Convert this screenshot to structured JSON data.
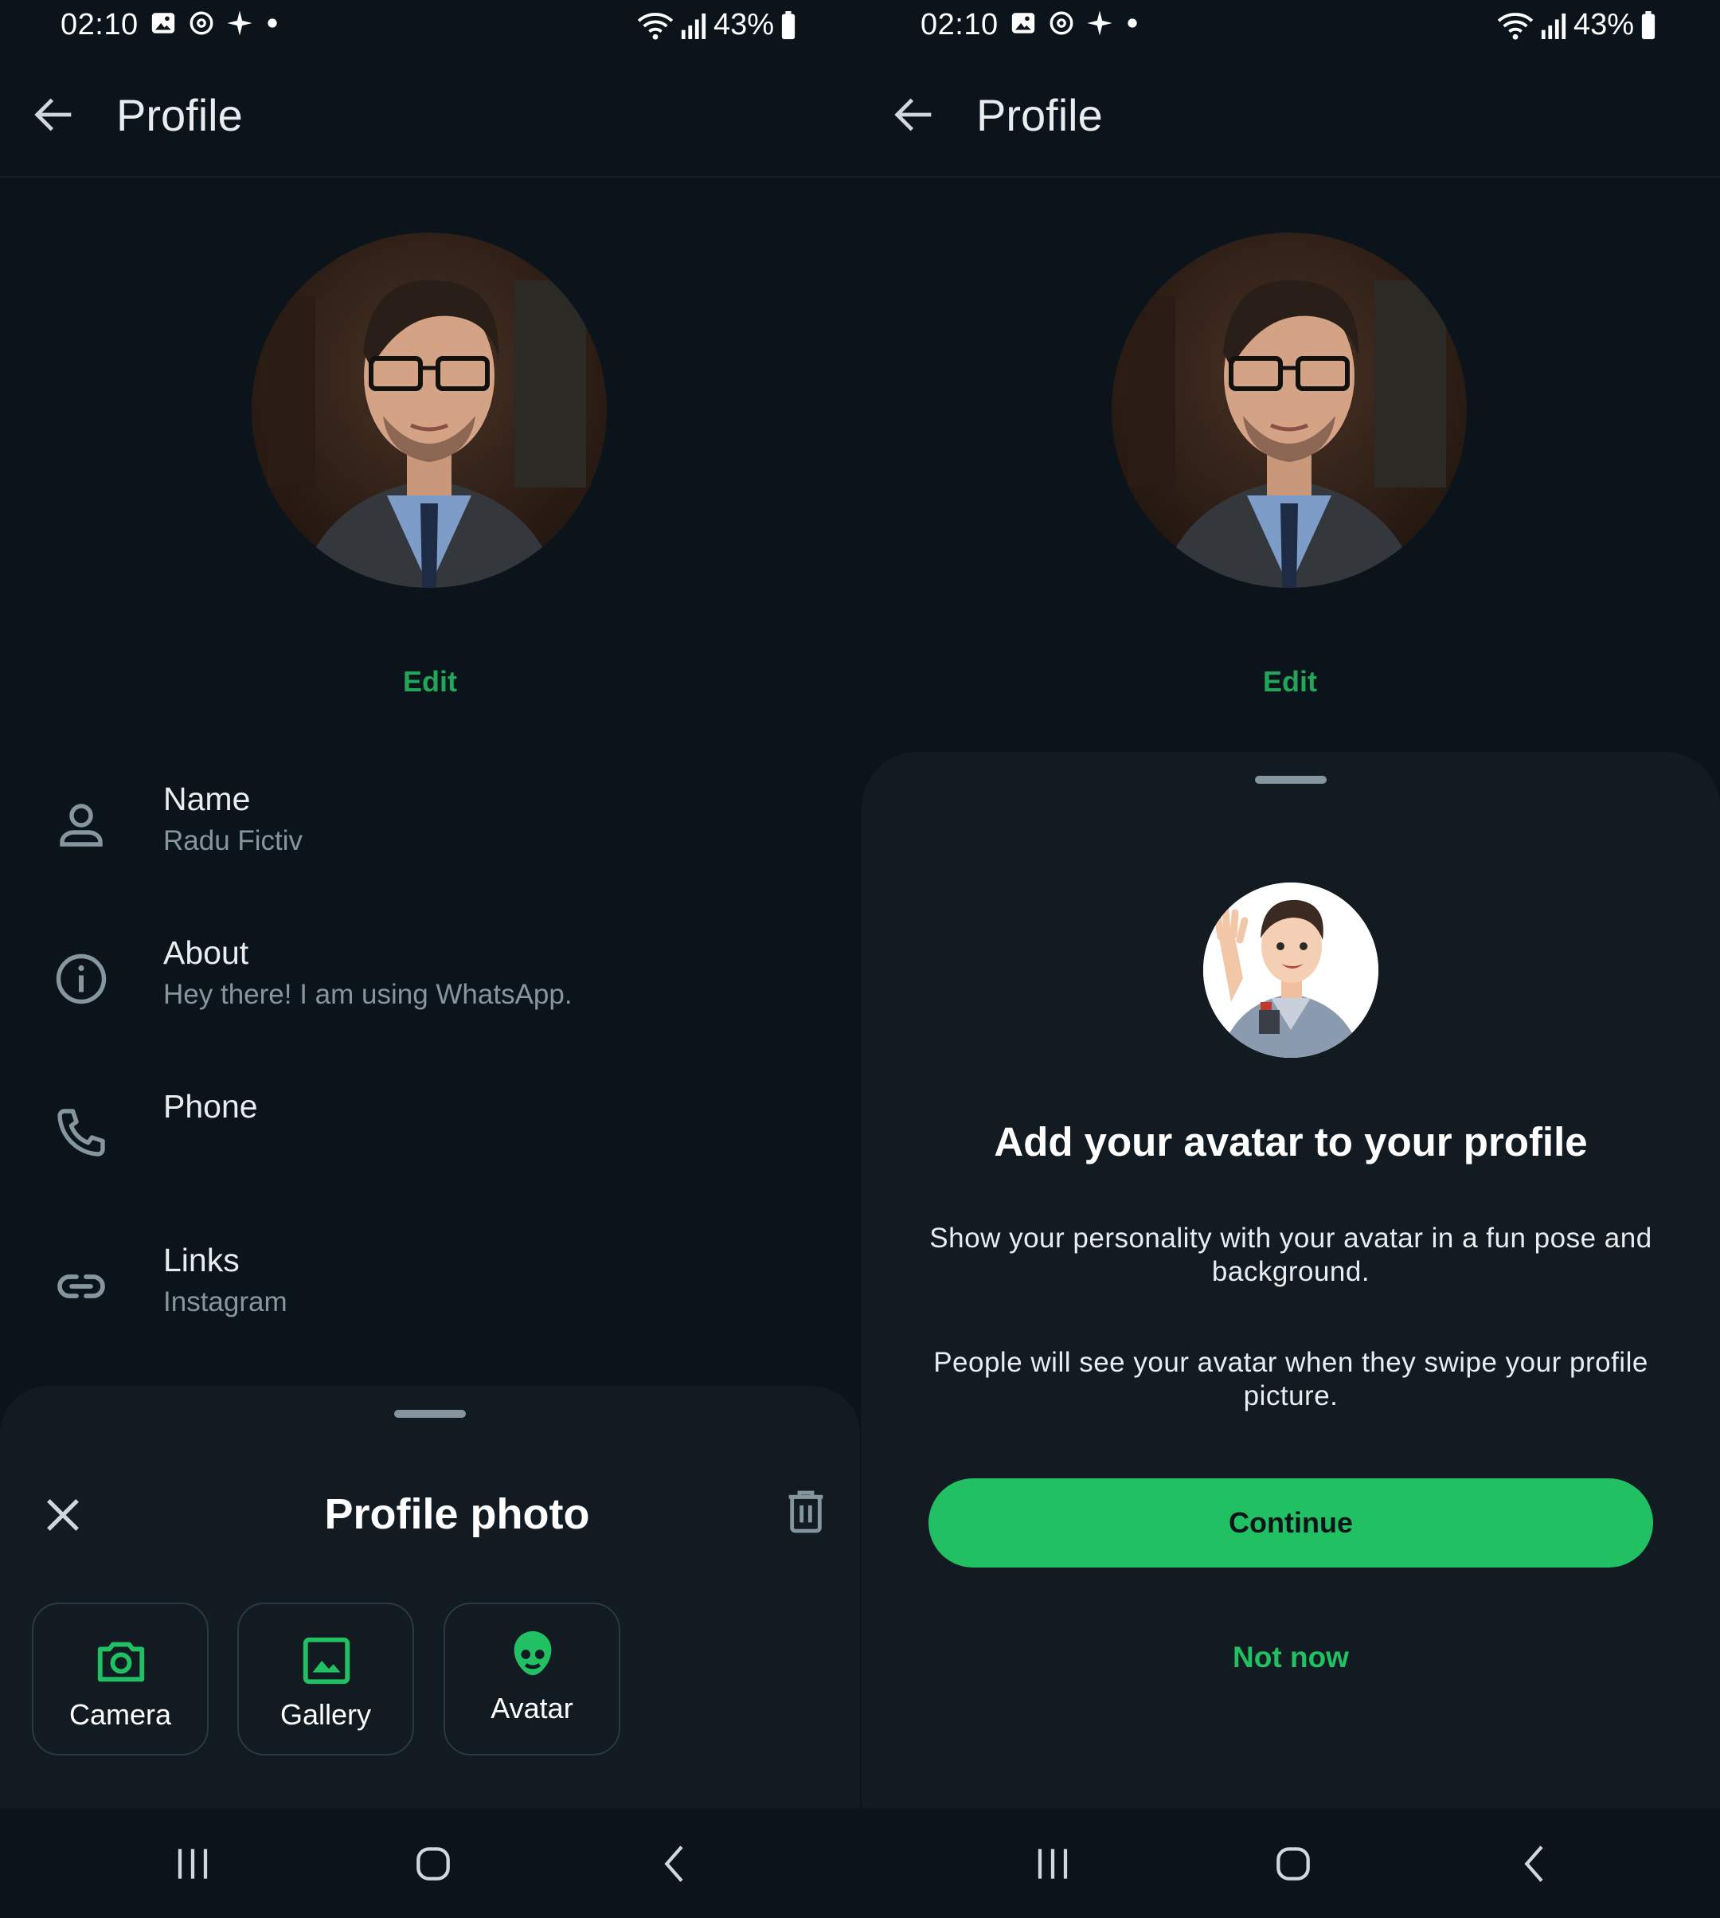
{
  "status_bar": {
    "time": "02:10",
    "battery": "43%"
  },
  "left": {
    "app_bar": {
      "title": "Profile"
    },
    "edit_label": "Edit",
    "rows": [
      {
        "label": "Name",
        "value": "Radu Fictiv",
        "icon": "person-icon"
      },
      {
        "label": "About",
        "value": "Hey there! I am using WhatsApp.",
        "icon": "info-icon"
      },
      {
        "label": "Phone",
        "value": "",
        "icon": "phone-icon"
      },
      {
        "label": "Links",
        "value": "Instagram",
        "icon": "link-icon"
      }
    ],
    "sheet": {
      "title": "Profile photo",
      "options": [
        {
          "label": "Camera",
          "icon": "camera-icon"
        },
        {
          "label": "Gallery",
          "icon": "gallery-icon"
        },
        {
          "label": "Avatar",
          "icon": "avatar-icon"
        }
      ]
    }
  },
  "right": {
    "app_bar": {
      "title": "Profile"
    },
    "edit_label": "Edit",
    "sheet": {
      "title": "Add your avatar to your profile",
      "text1": "Show your personality with your avatar in a fun pose and background.",
      "text2": "People will see your avatar when they swipe your profile picture.",
      "continue_label": "Continue",
      "not_now_label": "Not now"
    }
  },
  "colors": {
    "accent": "#21c063",
    "background": "#0b141a",
    "sheet": "#121b22",
    "edit": "#21a65a"
  }
}
